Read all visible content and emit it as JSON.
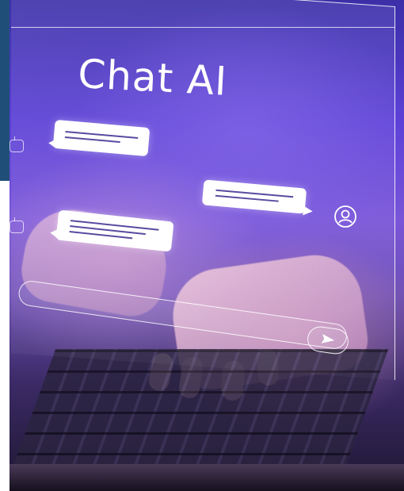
{
  "scene": {
    "title": "Chat AI",
    "description_colors": {
      "panel_left": "#1f4f78",
      "purple_main": "#5a3ed6",
      "purple_dark": "#1e1730",
      "bubble": "#ffffff",
      "bubble_lines": "#5a4aa0"
    }
  },
  "chat": {
    "bubbles": [
      {
        "role": "bot",
        "lines": 2
      },
      {
        "role": "user",
        "lines": 2
      },
      {
        "role": "bot",
        "lines": 3
      }
    ],
    "icons": [
      "bot-icon",
      "bot-icon",
      "user-icon",
      "send-icon"
    ]
  }
}
